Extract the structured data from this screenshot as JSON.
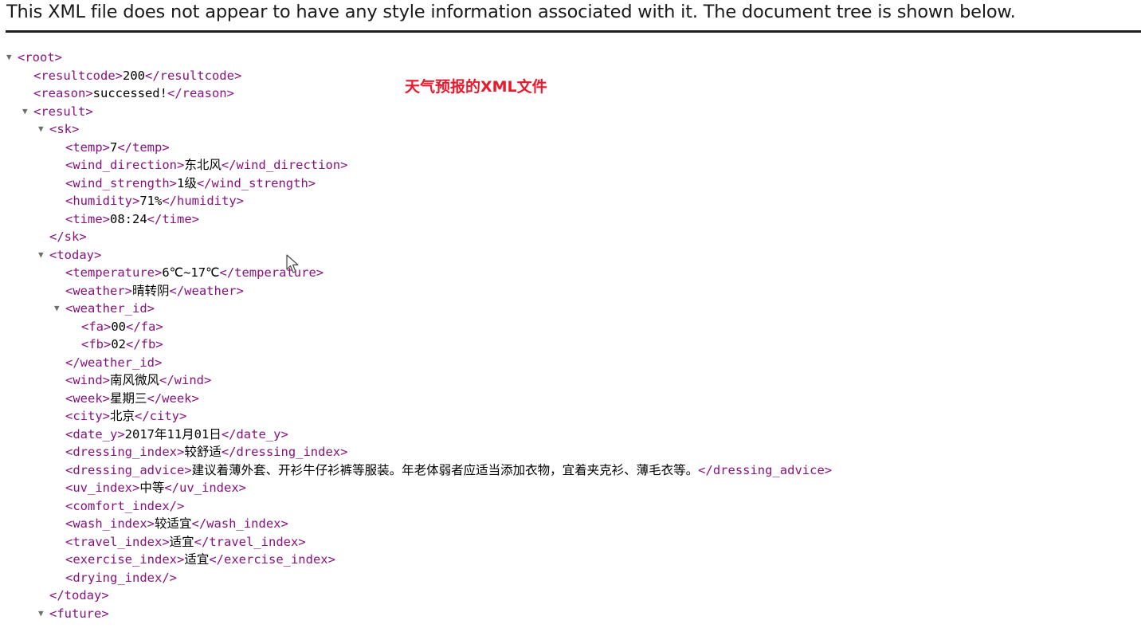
{
  "banner": {
    "message": "This XML file does not appear to have any style information associated with it. The document tree is shown below."
  },
  "annotation": {
    "text": "天气预报的XML文件",
    "color": "#e8192c"
  },
  "colors": {
    "tag": "#881280",
    "text": "#000000",
    "toggle": "#6e6e6e"
  },
  "icons": {
    "expanded": "triangle-down-icon",
    "pointer": "mouse-pointer-icon"
  },
  "tree": [
    {
      "depth": 0,
      "toggle": true,
      "open": "<root>",
      "text": "",
      "close": ""
    },
    {
      "depth": 1,
      "toggle": false,
      "open": "<resultcode>",
      "text": "200",
      "close": "</resultcode>"
    },
    {
      "depth": 1,
      "toggle": false,
      "open": "<reason>",
      "text": "successed!",
      "close": "</reason>"
    },
    {
      "depth": 1,
      "toggle": true,
      "open": "<result>",
      "text": "",
      "close": ""
    },
    {
      "depth": 2,
      "toggle": true,
      "open": "<sk>",
      "text": "",
      "close": ""
    },
    {
      "depth": 3,
      "toggle": false,
      "open": "<temp>",
      "text": "7",
      "close": "</temp>"
    },
    {
      "depth": 3,
      "toggle": false,
      "open": "<wind_direction>",
      "text": "东北风",
      "close": "</wind_direction>"
    },
    {
      "depth": 3,
      "toggle": false,
      "open": "<wind_strength>",
      "text": "1级",
      "close": "</wind_strength>"
    },
    {
      "depth": 3,
      "toggle": false,
      "open": "<humidity>",
      "text": "71%",
      "close": "</humidity>"
    },
    {
      "depth": 3,
      "toggle": false,
      "open": "<time>",
      "text": "08:24",
      "close": "</time>"
    },
    {
      "depth": 2,
      "toggle": false,
      "open": "</sk>",
      "text": "",
      "close": ""
    },
    {
      "depth": 2,
      "toggle": true,
      "open": "<today>",
      "text": "",
      "close": ""
    },
    {
      "depth": 3,
      "toggle": false,
      "open": "<temperature>",
      "text": "6℃~17℃",
      "close": "</temperature>"
    },
    {
      "depth": 3,
      "toggle": false,
      "open": "<weather>",
      "text": "晴转阴",
      "close": "</weather>"
    },
    {
      "depth": 3,
      "toggle": true,
      "open": "<weather_id>",
      "text": "",
      "close": ""
    },
    {
      "depth": 4,
      "toggle": false,
      "open": "<fa>",
      "text": "00",
      "close": "</fa>"
    },
    {
      "depth": 4,
      "toggle": false,
      "open": "<fb>",
      "text": "02",
      "close": "</fb>"
    },
    {
      "depth": 3,
      "toggle": false,
      "open": "</weather_id>",
      "text": "",
      "close": ""
    },
    {
      "depth": 3,
      "toggle": false,
      "open": "<wind>",
      "text": "南风微风",
      "close": "</wind>"
    },
    {
      "depth": 3,
      "toggle": false,
      "open": "<week>",
      "text": "星期三",
      "close": "</week>"
    },
    {
      "depth": 3,
      "toggle": false,
      "open": "<city>",
      "text": "北京",
      "close": "</city>"
    },
    {
      "depth": 3,
      "toggle": false,
      "open": "<date_y>",
      "text": "2017年11月01日",
      "close": "</date_y>"
    },
    {
      "depth": 3,
      "toggle": false,
      "open": "<dressing_index>",
      "text": "较舒适",
      "close": "</dressing_index>"
    },
    {
      "depth": 3,
      "toggle": false,
      "open": "<dressing_advice>",
      "text": "建议着薄外套、开衫牛仔衫裤等服装。年老体弱者应适当添加衣物，宜着夹克衫、薄毛衣等。",
      "close": "</dressing_advice>"
    },
    {
      "depth": 3,
      "toggle": false,
      "open": "<uv_index>",
      "text": "中等",
      "close": "</uv_index>"
    },
    {
      "depth": 3,
      "toggle": false,
      "open": "<comfort_index/>",
      "text": "",
      "close": ""
    },
    {
      "depth": 3,
      "toggle": false,
      "open": "<wash_index>",
      "text": "较适宜",
      "close": "</wash_index>"
    },
    {
      "depth": 3,
      "toggle": false,
      "open": "<travel_index>",
      "text": "适宜",
      "close": "</travel_index>"
    },
    {
      "depth": 3,
      "toggle": false,
      "open": "<exercise_index>",
      "text": "适宜",
      "close": "</exercise_index>"
    },
    {
      "depth": 3,
      "toggle": false,
      "open": "<drying_index/>",
      "text": "",
      "close": ""
    },
    {
      "depth": 2,
      "toggle": false,
      "open": "</today>",
      "text": "",
      "close": ""
    },
    {
      "depth": 2,
      "toggle": true,
      "open": "<future>",
      "text": "",
      "close": ""
    }
  ]
}
